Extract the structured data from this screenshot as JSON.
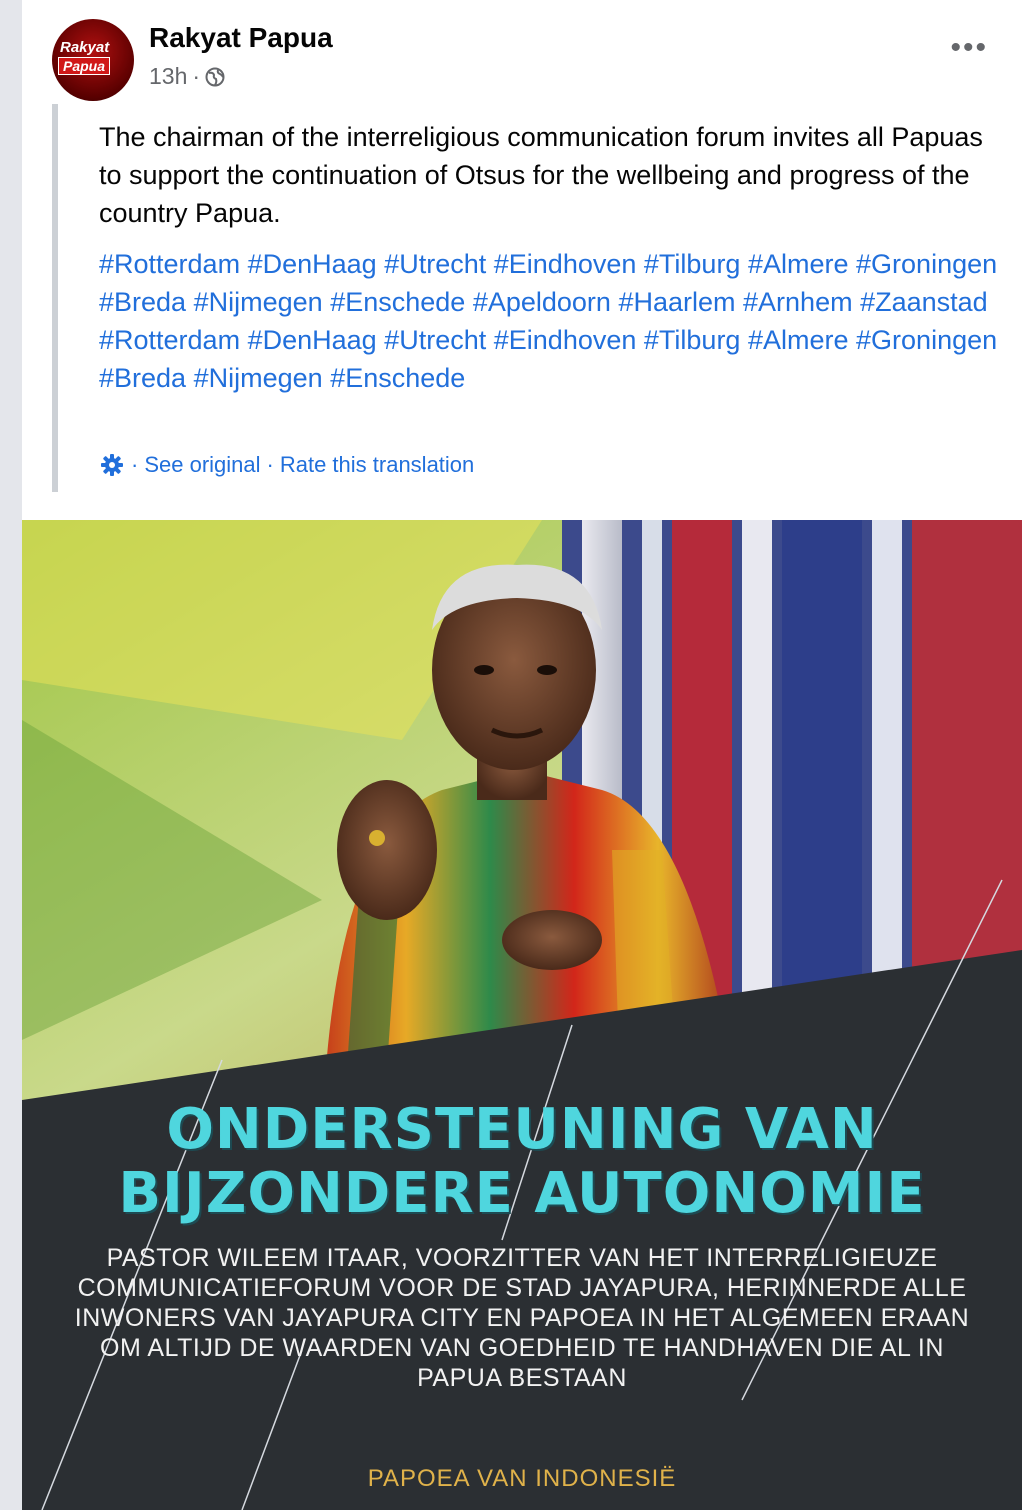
{
  "post": {
    "page_name": "Rakyat Papua",
    "avatar_logo_line1": "Rakyat",
    "avatar_logo_line2": "Papua",
    "time": "13h",
    "separator": "·",
    "more_label": "•••",
    "text": "The chairman of the interreligious communication forum invites all Papuas to support the continuation of Otsus for the wellbeing and progress of the country Papua.",
    "hashtags": [
      "#Rotterdam",
      "#DenHaag",
      "#Utrecht",
      "#Eindhoven",
      "#Tilburg",
      "#Almere",
      "#Groningen",
      "#Breda",
      "#Nijmegen",
      "#Enschede",
      "#Apeldoorn",
      "#Haarlem",
      "#Arnhem",
      "#Zaanstad",
      "#Rotterdam",
      "#DenHaag",
      "#Utrecht",
      "#Eindhoven",
      "#Tilburg",
      "#Almere",
      "#Groningen",
      "#Breda",
      "#Nijmegen",
      "#Enschede"
    ],
    "translation": {
      "sep1": "·",
      "see_original": "See original",
      "sep2": "·",
      "rate": "Rate this translation"
    }
  },
  "image": {
    "headline_line1": "ONDERSTEUNING VAN",
    "headline_line2": "BIJZONDERE AUTONOMIE",
    "subtext": "PASTOR WILEEM ITAAR, VOORZITTER VAN HET INTERRELIGIEUZE COMMUNICATIEFORUM VOOR DE STAD JAYAPURA, HERINNERDE ALLE INWONERS VAN JAYAPURA CITY EN PAPOEA IN HET ALGEMEEN ERAAN OM ALTIJD DE WAARDEN VAN GOEDHEID TE HANDHAVEN DIE AL IN PAPUA BESTAAN",
    "footer": "PAPOEA VAN INDONESIË"
  },
  "colors": {
    "link": "#216fdb",
    "headline": "#4fd6de",
    "footer": "#e0b24a",
    "panel": "#2b2f33"
  }
}
